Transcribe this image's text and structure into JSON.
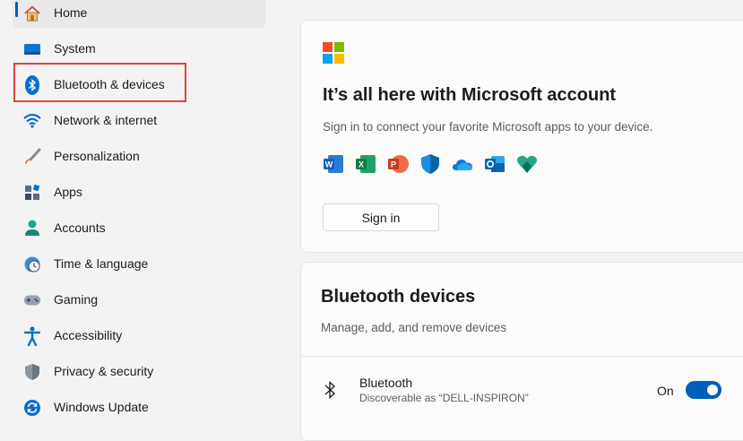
{
  "sidebar": {
    "items": [
      {
        "label": "Home",
        "icon": "home-icon"
      },
      {
        "label": "System",
        "icon": "system-icon"
      },
      {
        "label": "Bluetooth & devices",
        "icon": "bluetooth-icon"
      },
      {
        "label": "Network & internet",
        "icon": "wifi-icon"
      },
      {
        "label": "Personalization",
        "icon": "brush-icon"
      },
      {
        "label": "Apps",
        "icon": "apps-icon"
      },
      {
        "label": "Accounts",
        "icon": "person-icon"
      },
      {
        "label": "Time & language",
        "icon": "clock-globe-icon"
      },
      {
        "label": "Gaming",
        "icon": "gamepad-icon"
      },
      {
        "label": "Accessibility",
        "icon": "accessibility-icon"
      },
      {
        "label": "Privacy & security",
        "icon": "shield-icon"
      },
      {
        "label": "Windows Update",
        "icon": "update-icon"
      }
    ],
    "selected": "Home",
    "highlighted": "Bluetooth & devices"
  },
  "microsoft_account": {
    "title": "It’s all here with Microsoft account",
    "subtitle": "Sign in to connect your favorite Microsoft apps to your device.",
    "apps": [
      "word-icon",
      "excel-icon",
      "powerpoint-icon",
      "defender-icon",
      "onedrive-icon",
      "outlook-icon",
      "family-safety-icon"
    ],
    "sign_in_label": "Sign in"
  },
  "bluetooth_devices": {
    "title": "Bluetooth devices",
    "subtitle": "Manage, add, and remove devices",
    "row": {
      "name": "Bluetooth",
      "description": "Discoverable as “DELL-INSPIRON”",
      "state_label": "On",
      "toggle_on": true
    }
  },
  "colors": {
    "accent": "#005fb8",
    "highlight_box": "#e0443e"
  }
}
